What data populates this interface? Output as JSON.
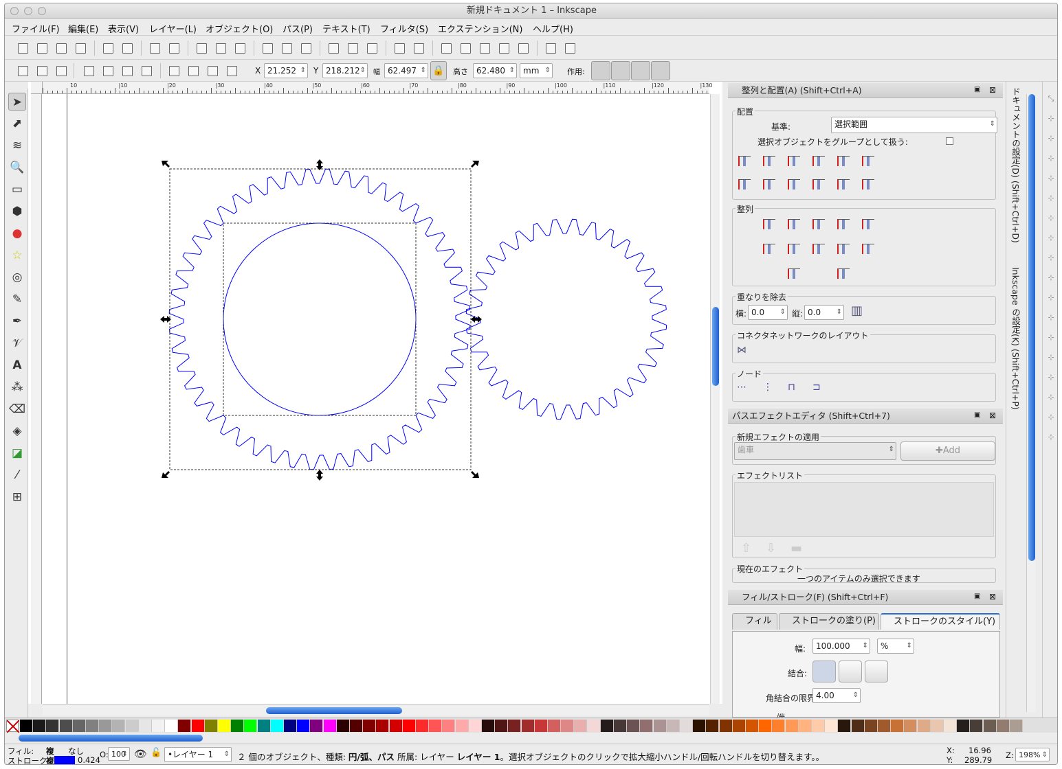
{
  "window": {
    "title": "新規ドキュメント 1 – Inkscape"
  },
  "menu": [
    "ファイル(F)",
    "編集(E)",
    "表示(V)",
    "レイヤー(L)",
    "オブジェクト(O)",
    "パス(P)",
    "テキスト(T)",
    "フィルタ(S)",
    "エクステンション(N)",
    "ヘルプ(H)"
  ],
  "toolcontrols": {
    "x_label": "X",
    "x_value": "21.252",
    "y_label": "Y",
    "y_value": "218.212",
    "w_label": "幅",
    "w_value": "62.497",
    "h_label": "高さ",
    "h_value": "62.480",
    "unit": "mm",
    "affect_label": "作用:"
  },
  "ruler_ticks": [
    "10",
    "|10",
    "|20",
    "|30",
    "|40",
    "|50",
    "|60",
    "|70",
    "|80",
    "|90",
    "|100",
    "|110",
    "|120",
    "|130"
  ],
  "align_panel": {
    "title": "整列と配置(A) (Shift+Ctrl+A)",
    "section_align": "配置",
    "relative_label": "基準:",
    "relative_value": "選択範囲",
    "group_label": "選択オブジェクトをグループとして扱う:",
    "section_distribute": "整列",
    "section_overlap": "重なりを除去",
    "h_label": "横:",
    "h_value": "0.0",
    "v_label": "縦:",
    "v_value": "0.0",
    "section_connector": "コネクタネットワークのレイアウト",
    "section_nodes": "ノード"
  },
  "lpe_panel": {
    "title": "パスエフェクトエディタ (Shift+Ctrl+7)",
    "section_apply": "新規エフェクトの適用",
    "effect_value": "歯車",
    "add_label": "Add",
    "section_list": "エフェクトリスト",
    "section_current": "現在のエフェクト",
    "current_msg": "一つのアイテムのみ選択できます"
  },
  "fill_panel": {
    "title": "フィル/ストローク(F) (Shift+Ctrl+F)",
    "tabs": [
      "フィル",
      "ストロークの塗り(P)",
      "ストロークのスタイル(Y)"
    ],
    "width_label": "幅:",
    "width_value": "100.000",
    "width_unit": "%",
    "join_label": "結合:",
    "miter_label": "角結合の限界:",
    "miter_value": "4.00",
    "cap_label": "端"
  },
  "dock": {
    "doc_props": "ドキュメントの設定(D) (Shift+Ctrl+D)",
    "prefs": "Inkscape の設定(K) (Shift+Ctrl+P)"
  },
  "palette_colors": [
    "#000000",
    "#1a1a1a",
    "#333333",
    "#4d4d4d",
    "#666666",
    "#808080",
    "#999999",
    "#b3b3b3",
    "#cccccc",
    "#e6e6e6",
    "#f2f2f2",
    "#ffffff",
    "#800000",
    "#ff0000",
    "#808000",
    "#ffff00",
    "#008000",
    "#00ff00",
    "#008080",
    "#00ffff",
    "#000080",
    "#0000ff",
    "#800080",
    "#ff00ff",
    "#2b0000",
    "#550000",
    "#800000",
    "#aa0000",
    "#d40000",
    "#ff0000",
    "#ff2a2a",
    "#ff5555",
    "#ff8080",
    "#ffaaaa",
    "#ffd5d5",
    "#280b0b",
    "#501616",
    "#782121",
    "#a02c2c",
    "#c83737",
    "#d35f5f",
    "#de8787",
    "#e9afaf",
    "#f4d7d7",
    "#241c1c",
    "#483737",
    "#6c5353",
    "#916f6f",
    "#ac9393",
    "#c8b7b7",
    "#e3dbdb",
    "#2b1100",
    "#552200",
    "#803300",
    "#aa4400",
    "#d45500",
    "#ff6600",
    "#ff7f2a",
    "#ff9955",
    "#ffb380",
    "#ffccaa",
    "#ffe6d5",
    "#28170b",
    "#502d16",
    "#784421",
    "#a05a2c",
    "#c87137",
    "#d38d5f",
    "#deaa87",
    "#e9c6af",
    "#f4e3d7",
    "#241f1c",
    "#483e37",
    "#6c5d53",
    "#917c6f",
    "#ac9d93"
  ],
  "status": {
    "fill_label": "フィル:",
    "fill_value": "複",
    "stroke_label": "ストローク:",
    "stroke_value": "複",
    "none_label": "なし",
    "stroke_width": "0.424",
    "opacity_label": "O:",
    "opacity_value": "100",
    "layer_value": "•レイヤー 1",
    "message_pre": "２ 個のオブジェクト、種類: ",
    "message_types": "円/弧、パス",
    "message_mid": " 所属: レイヤー ",
    "message_layer": "レイヤー 1",
    "message_post": "。選択オブジェクトのクリックで拡大縮小ハンドル/回転ハンドルを切り替えます。。",
    "cursor_x_label": "X:",
    "cursor_x": "16.96",
    "cursor_y_label": "Y:",
    "cursor_y": "289.79",
    "zoom_label": "Z:",
    "zoom_value": "198%"
  },
  "colors": {
    "accent": "#2a6bd0",
    "stroke_blue": "#0000ff"
  }
}
